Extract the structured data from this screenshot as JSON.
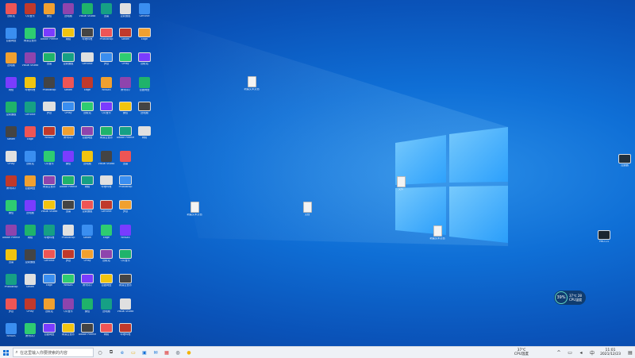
{
  "colors": {
    "wallpaper": "#0f6fd6",
    "taskbar": "#eef1f6",
    "accent": "#0f6fd6"
  },
  "search": {
    "placeholder": "在这里输入你要搜索的内容"
  },
  "weather": {
    "percent": "39%",
    "line1": "37℃ 28",
    "line2": "CPU温度"
  },
  "tray": {
    "temp": "37℃",
    "weather": "CPU温度",
    "time": "11:01",
    "date": "2021/12/23"
  },
  "desktop_files": [
    {
      "label": "新建文本文档"
    },
    {
      "label": "文件"
    },
    {
      "label": "新建文本文档"
    },
    {
      "label": "新建文本文档"
    },
    {
      "label": "文档"
    },
    {
      "label": "新建文本文档"
    }
  ],
  "right_icons": [
    {
      "label": "加速器"
    },
    {
      "label": "PMD-CS"
    }
  ],
  "grid_labels": [
    "回收站",
    "百度网盘",
    "此电脑",
    "网络",
    "控制面板",
    "Steam",
    "UPlay",
    "腾讯QQ",
    "微信",
    "Adobe Premiere",
    "迅雷",
    "Photoshop",
    "罗技",
    "NVIDIA",
    "QQ音乐",
    "网易云音乐",
    "Visual Studio",
    "哔哩哔哩",
    "GeForce",
    "Edge"
  ],
  "taskbar_apps": [
    "task-view",
    "edge",
    "file-explorer",
    "store",
    "mail",
    "office",
    "steam",
    "app-yellow"
  ]
}
